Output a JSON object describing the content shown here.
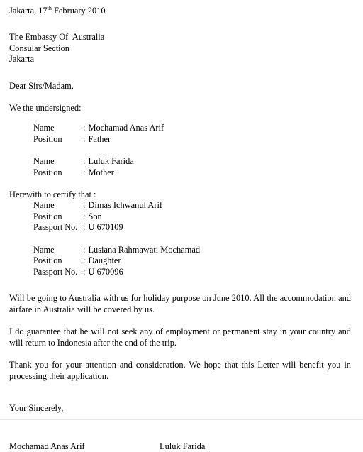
{
  "document": {
    "type": "sponsorship-letter",
    "date_line": {
      "city": "Jakarta, ",
      "day": "17",
      "ordinal_suffix": "th",
      "rest": " February 2010"
    },
    "recipient": {
      "line1": "The Embassy Of  Australia",
      "line2": "Consular Section",
      "line3": "Jakarta"
    },
    "salutation": "Dear Sirs/Madam,",
    "undersigned_heading": "We the undersigned:",
    "undersigned": [
      {
        "rows": [
          {
            "label": "Name",
            "sep": ":",
            "value": "Mochamad Anas Arif"
          },
          {
            "label": "Position",
            "sep": ":",
            "value": "Father"
          }
        ]
      },
      {
        "rows": [
          {
            "label": "Name",
            "sep": ":",
            "value": "Luluk Farida"
          },
          {
            "label": "Position",
            "sep": ":",
            "value": "Mother"
          }
        ]
      }
    ],
    "certify_heading": "Herewith to certify that :",
    "certified": [
      {
        "rows": [
          {
            "label": "Name",
            "sep": ":",
            "value": "Dimas Ichwanul Arif"
          },
          {
            "label": "Position",
            "sep": ":",
            "value": "Son"
          },
          {
            "label": "Passport No.",
            "sep": ":",
            "value": "U 670109"
          }
        ]
      },
      {
        "rows": [
          {
            "label": "Name",
            "sep": ":",
            "value": "Lusiana Rahmawati Mochamad"
          },
          {
            "label": "Position",
            "sep": ":",
            "value": "Daughter"
          },
          {
            "label": "Passport No.",
            "sep": ":",
            "value": "U 670096"
          }
        ]
      }
    ],
    "paragraphs": [
      "Will be going to Australia with us for holiday purpose on June 2010. All the accommodation and airfare in Australia will be covered by us.",
      "I do guarantee that he will not seek any of employment or permanent stay in your country and will return to Indonesia after the end of the trip.",
      "Thank you for your attention and consideration. We hope that this Letter will benefit you in processing their application."
    ],
    "closing": "Your Sincerely,",
    "signatures": {
      "left": "Mochamad Anas Arif",
      "right": "Luluk Farida"
    }
  }
}
